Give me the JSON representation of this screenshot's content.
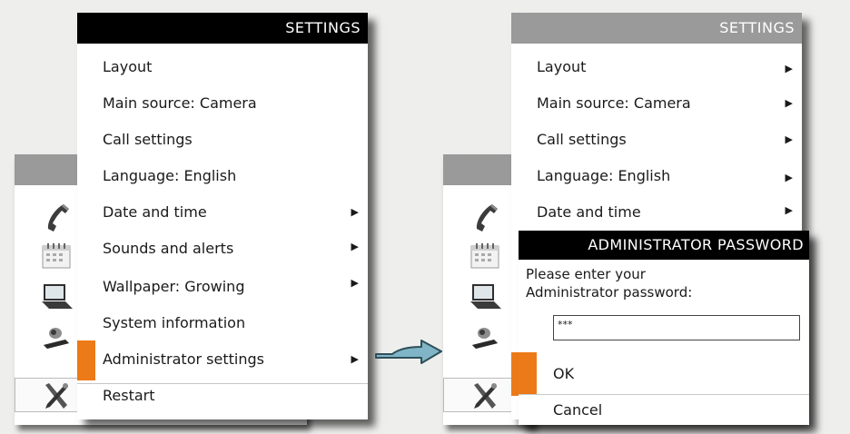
{
  "left_menu": {
    "title": "SETTINGS",
    "items": [
      {
        "label": "Layout"
      },
      {
        "label": "Main source: Camera"
      },
      {
        "label": "Call settings"
      },
      {
        "label": "Language: English"
      },
      {
        "label": "Date and time",
        "arrow": "▶"
      },
      {
        "label": "Sounds and alerts",
        "arrow": "▶"
      },
      {
        "label": "Wallpaper: Growing",
        "arrow": "▶"
      },
      {
        "label": "System information"
      },
      {
        "label": "Administrator settings",
        "arrow": "▶",
        "selected": true
      },
      {
        "label": "Restart"
      }
    ]
  },
  "right_menu": {
    "title": "SETTINGS",
    "items": [
      {
        "label": "Layout",
        "arrow": "▶"
      },
      {
        "label": "Main source: Camera",
        "arrow": "▶"
      },
      {
        "label": "Call settings",
        "arrow": "▶"
      },
      {
        "label": "Language: English",
        "arrow": "▶"
      },
      {
        "label": "Date and time",
        "arrow": "▶"
      }
    ]
  },
  "dock_icons": [
    "phone-icon",
    "calendar-icon",
    "laptop-icon",
    "camera-icon",
    "tools-icon"
  ],
  "dialog": {
    "title": "ADMINISTRATOR PASSWORD",
    "prompt_line1": "Please enter your",
    "prompt_line2": "Administrator password:",
    "password_value": "***",
    "ok_label": "OK",
    "cancel_label": "Cancel"
  },
  "colors": {
    "accent": "#ec7a18",
    "header_dark": "#000000",
    "header_gray": "#999a99",
    "arrow_fill": "#7fb5c6"
  }
}
